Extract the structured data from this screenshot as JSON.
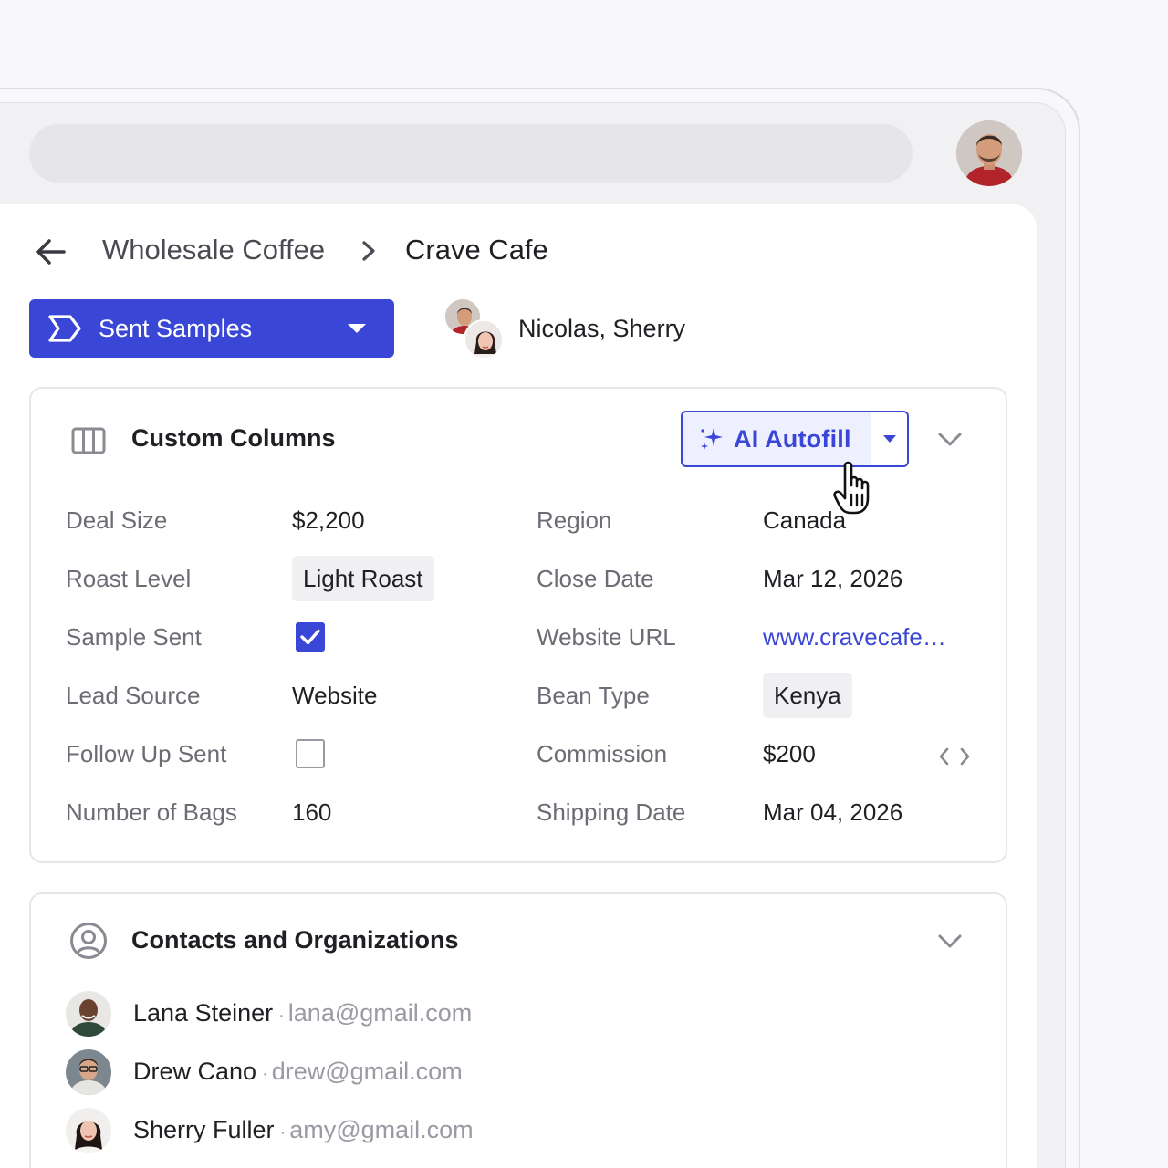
{
  "header": {
    "search_placeholder": "",
    "profile_avatar": "user-avatar"
  },
  "breadcrumb": {
    "back_icon": "arrow-left-icon",
    "parent": "Wholesale Coffee",
    "separator_icon": "chevron-right-icon",
    "current": "Crave Cafe"
  },
  "stage": {
    "label": "Sent Samples",
    "icon": "pipeline-stage-icon",
    "caret_icon": "caret-down-icon",
    "color": "#3a46d6"
  },
  "owners": {
    "label": "Nicolas, Sherry"
  },
  "custom_columns": {
    "title": "Custom Columns",
    "icon": "columns-icon",
    "ai_button": {
      "label": "AI Autofill",
      "icon": "sparkle-icon",
      "caret_icon": "caret-down-icon"
    },
    "collapse_icon": "chevron-down-icon",
    "left_fields": [
      {
        "label": "Deal Size",
        "value": "$2,200"
      },
      {
        "label": "Roast Level",
        "value": "Light Roast",
        "type": "chip"
      },
      {
        "label": "Sample Sent",
        "checked": true,
        "type": "checkbox"
      },
      {
        "label": "Lead Source",
        "value": "Website"
      },
      {
        "label": "Follow Up Sent",
        "checked": false,
        "type": "checkbox"
      },
      {
        "label": "Number of Bags",
        "value": "160"
      }
    ],
    "right_fields": [
      {
        "label": "Region",
        "value": "Canada"
      },
      {
        "label": "Close Date",
        "value": "Mar 12, 2026"
      },
      {
        "label": "Website URL",
        "value": "www.cravecafe…",
        "type": "link"
      },
      {
        "label": "Bean Type",
        "value": "Kenya",
        "type": "chip"
      },
      {
        "label": "Commission",
        "value": "$200"
      },
      {
        "label": "Shipping Date",
        "value": "Mar 04, 2026"
      }
    ],
    "formula_icon": "code-icon"
  },
  "contacts": {
    "title": "Contacts and Organizations",
    "icon": "user-circle-icon",
    "collapse_icon": "chevron-down-icon",
    "separator": "·",
    "items": [
      {
        "name": "Lana Steiner",
        "email": "lana@gmail.com"
      },
      {
        "name": "Drew Cano",
        "email": "drew@gmail.com"
      },
      {
        "name": "Sherry Fuller",
        "email": "amy@gmail.com"
      }
    ]
  }
}
